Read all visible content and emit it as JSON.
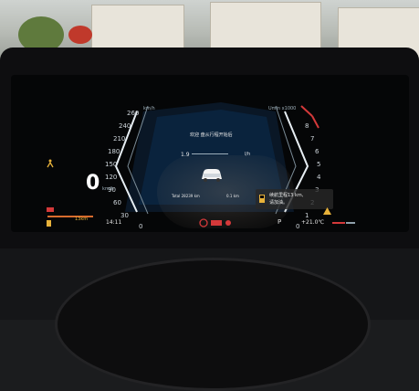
{
  "cluster": {
    "speed_unit": "km/h",
    "speed_value": "0",
    "speed_value_unit": "km/h",
    "speed_ticks": [
      "260",
      "240",
      "210",
      "180",
      "150",
      "120",
      "90",
      "60",
      "30",
      "0"
    ],
    "rpm_unit": "Umin x1000",
    "rpm_ticks": [
      "8",
      "7",
      "6",
      "5",
      "4",
      "3",
      "2",
      "1",
      "0"
    ],
    "message_title": "欢迎 盘从行程开始后",
    "trip_value": "1.9",
    "trip_unit": "l/h",
    "total_mileage": "Total 28239 km",
    "trip_distance": "0.1 km",
    "range_warning": "续航里程13 km,",
    "range_warning_line2": "请加油。",
    "fuel_range": "13km",
    "time": "14:11",
    "gear": "P",
    "temperature": "+21.0℃"
  }
}
